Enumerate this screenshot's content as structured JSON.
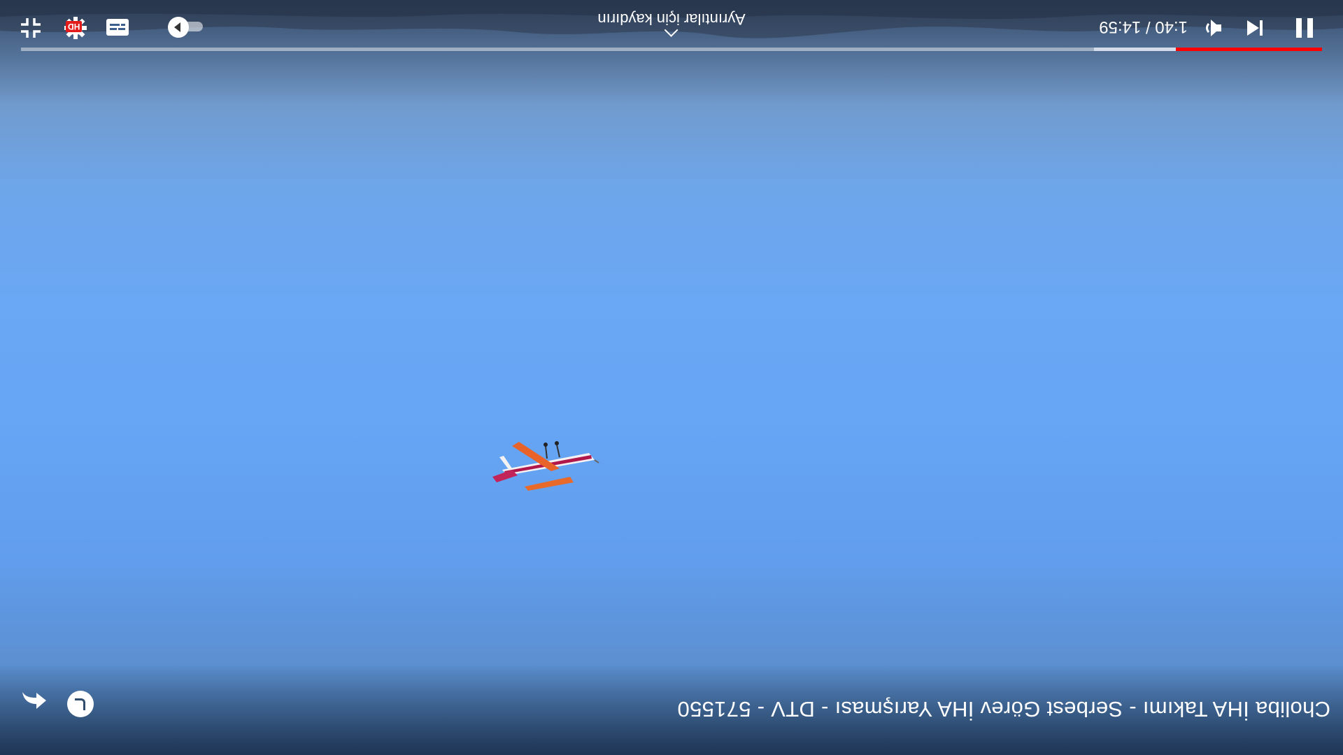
{
  "video": {
    "title": "Choliba İHA Takımı - Serbest Görev İHA Yarışması - DTV - 571550"
  },
  "controls": {
    "current_time": "1:40",
    "duration": "14:59",
    "time_display": "1:40 / 14:59",
    "swipe_hint": "Ayrıntılar için kaydırın",
    "quality_badge": "HD",
    "progress_played_fraction": 0.1125,
    "progress_buffered_fraction": 0.175,
    "autoplay_on": false
  },
  "icons": {
    "back": "back-arrow-icon",
    "round": "round-action-icon",
    "pause": "pause-icon",
    "previous": "skip-previous-icon",
    "volume": "volume-icon",
    "autoplay": "autoplay-toggle-icon",
    "captions": "captions-icon",
    "settings": "gear-icon",
    "exit_fullscreen": "exit-fullscreen-icon"
  },
  "colors": {
    "progress_played": "#ff0000",
    "hd_badge": "#e41b1b"
  }
}
